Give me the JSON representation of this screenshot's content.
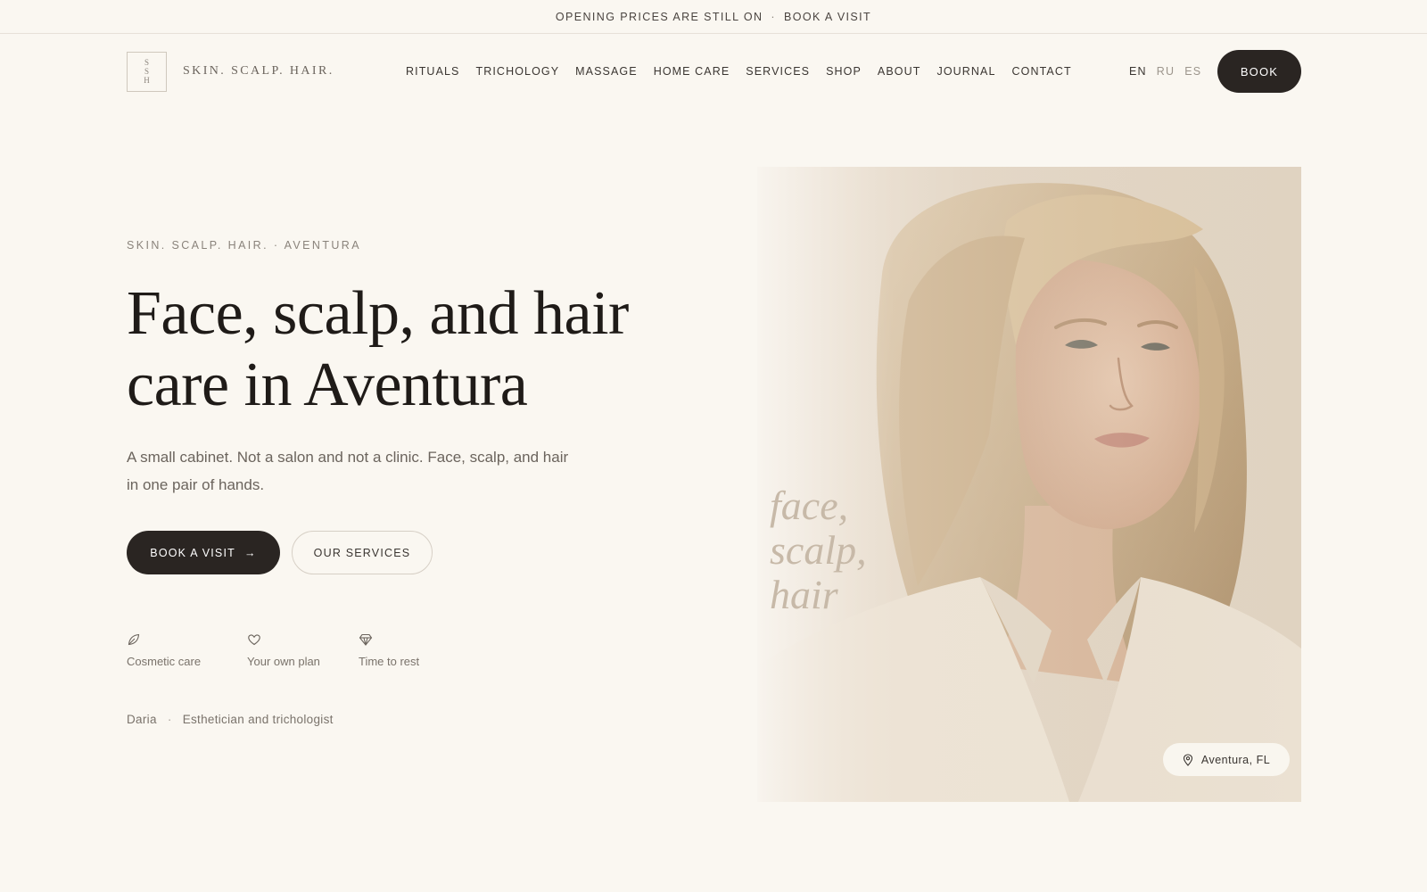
{
  "announcement": {
    "text": "OPENING PRICES ARE STILL ON",
    "separator": "·",
    "link": "BOOK A VISIT"
  },
  "header": {
    "logo_letters": [
      "S",
      "S",
      "H"
    ],
    "logo_text": "SKIN. SCALP. HAIR.",
    "nav": [
      "RITUALS",
      "TRICHOLOGY",
      "MASSAGE",
      "HOME CARE",
      "SERVICES",
      "SHOP",
      "ABOUT",
      "JOURNAL",
      "CONTACT"
    ],
    "languages": [
      "EN",
      "RU",
      "ES"
    ],
    "active_language": "EN",
    "book_label": "BOOK"
  },
  "hero": {
    "eyebrow": "SKIN. SCALP. HAIR. · AVENTURA",
    "title_line1": "Face, scalp, and hair",
    "title_line2": "care in Aventura",
    "lead": "A small cabinet. Not a salon and not a clinic. Face, scalp, and hair in one pair of hands.",
    "primary_cta": "BOOK A VISIT",
    "primary_cta_arrow": "→",
    "secondary_cta": "OUR SERVICES",
    "features": [
      {
        "icon": "leaf-icon",
        "label": "Cosmetic care"
      },
      {
        "icon": "heart-icon",
        "label": "Your own plan"
      },
      {
        "icon": "diamond-icon",
        "label": "Time to rest"
      }
    ],
    "byline_name": "Daria",
    "byline_separator": "·",
    "byline_role": "Esthetician and trichologist"
  },
  "photo": {
    "script_lines": [
      "face,",
      "scalp,",
      "hair"
    ],
    "location": "Aventura, FL",
    "location_icon": "map-pin-icon"
  },
  "colors": {
    "background": "#faf7f1",
    "ink": "#2a2522",
    "muted": "#7a736b",
    "border": "#d6cfc5"
  }
}
